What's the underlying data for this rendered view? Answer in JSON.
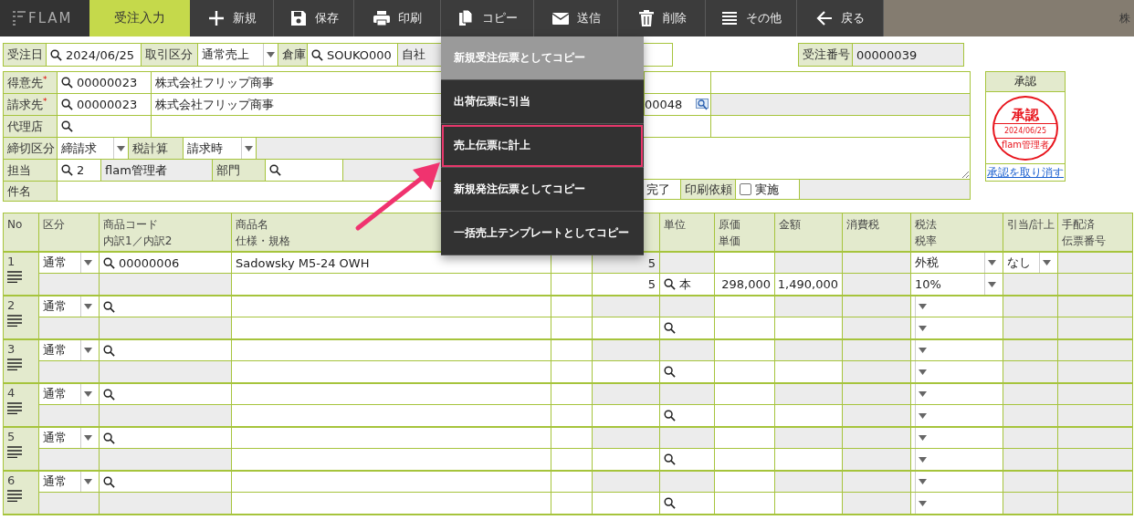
{
  "topbar": {
    "logo": "FLAM",
    "active_tab": "受注入力",
    "toolbar": [
      {
        "label": "新規",
        "kind": "plus"
      },
      {
        "label": "保存",
        "kind": "save"
      },
      {
        "label": "印刷",
        "kind": "print"
      },
      {
        "label": "コピー",
        "kind": "copy"
      },
      {
        "label": "送信",
        "kind": "mail"
      },
      {
        "label": "削除",
        "kind": "trash"
      },
      {
        "label": "その他",
        "kind": "list"
      },
      {
        "label": "戻る",
        "kind": "back"
      }
    ],
    "company": "株"
  },
  "header": {
    "order_date_label": "受注日",
    "order_date": "2024/06/25",
    "deal_type_label": "取引区分",
    "deal_type": "通常売上",
    "warehouse_label": "倉庫",
    "warehouse_code": "SOUKO000",
    "warehouse_name": "自社",
    "order_no_label": "受注番号",
    "order_no": "00000039"
  },
  "parties": {
    "customer_label": "得意先",
    "customer_mark": "*",
    "customer_code": "00000023",
    "customer_name": "株式会社フリップ商事",
    "billing_label": "請求先",
    "billing_mark": "*",
    "billing_code": "00000023",
    "billing_name": "株式会社フリップ商事",
    "billing_extra": "00048",
    "agent_label": "代理店",
    "closing_label": "締切区分",
    "closing": "締請求",
    "tax_calc_label": "税計算",
    "tax_calc": "請求時",
    "staff_label": "担当",
    "staff_code": "2",
    "staff_name": "flam管理者",
    "dept_label": "部門",
    "subject_label": "件名",
    "status_fragment": "完了",
    "print_label": "印刷依頼",
    "print_option": "実施",
    "print_checked": false
  },
  "approval": {
    "title": "承認",
    "stamp_title": "承認",
    "stamp_date": "2024/06/25",
    "stamp_user": "flam管理者",
    "cancel_link": "承認を取り消す"
  },
  "copy_menu": [
    {
      "label": "新規受注伝票としてコピー",
      "hovered": true,
      "outlined": false
    },
    {
      "label": "出荷伝票に引当",
      "hovered": false,
      "outlined": false
    },
    {
      "label": "売上伝票に計上",
      "hovered": false,
      "outlined": true
    },
    {
      "label": "新規発注伝票としてコピー",
      "hovered": false,
      "outlined": false
    },
    {
      "label": "一括売上テンプレートとしてコピー",
      "hovered": false,
      "outlined": false
    }
  ],
  "table": {
    "columns": [
      {
        "label": "No"
      },
      {
        "label": "区分"
      },
      {
        "label": "商品コード",
        "sub": "内訳1／内訳2"
      },
      {
        "label": "商品名",
        "sub": "仕様・規格"
      },
      {},
      {},
      {
        "label": "単位"
      },
      {
        "label": "原価",
        "sub": "単価"
      },
      {
        "label": "金額"
      },
      {
        "label": "消費税"
      },
      {
        "label": "税法",
        "sub": "税率"
      },
      {
        "label": "引当/計上"
      },
      {
        "label": "手配済",
        "sub": "伝票番号"
      }
    ],
    "rows": [
      {
        "no": "1",
        "category": "通常",
        "product_code": "00000006",
        "product_name": "Sadowsky M5-24 OWH",
        "quantity": "5",
        "quantity_2": "5",
        "unit": "本",
        "unit_price": "298,000",
        "amount": "1,490,000",
        "tax_type": "外税",
        "tax_rate": "10%",
        "allocation": "なし"
      },
      {
        "no": "2",
        "category": "通常"
      },
      {
        "no": "3",
        "category": "通常"
      },
      {
        "no": "4",
        "category": "通常"
      },
      {
        "no": "5",
        "category": "通常"
      },
      {
        "no": "6",
        "category": "通常"
      }
    ]
  }
}
